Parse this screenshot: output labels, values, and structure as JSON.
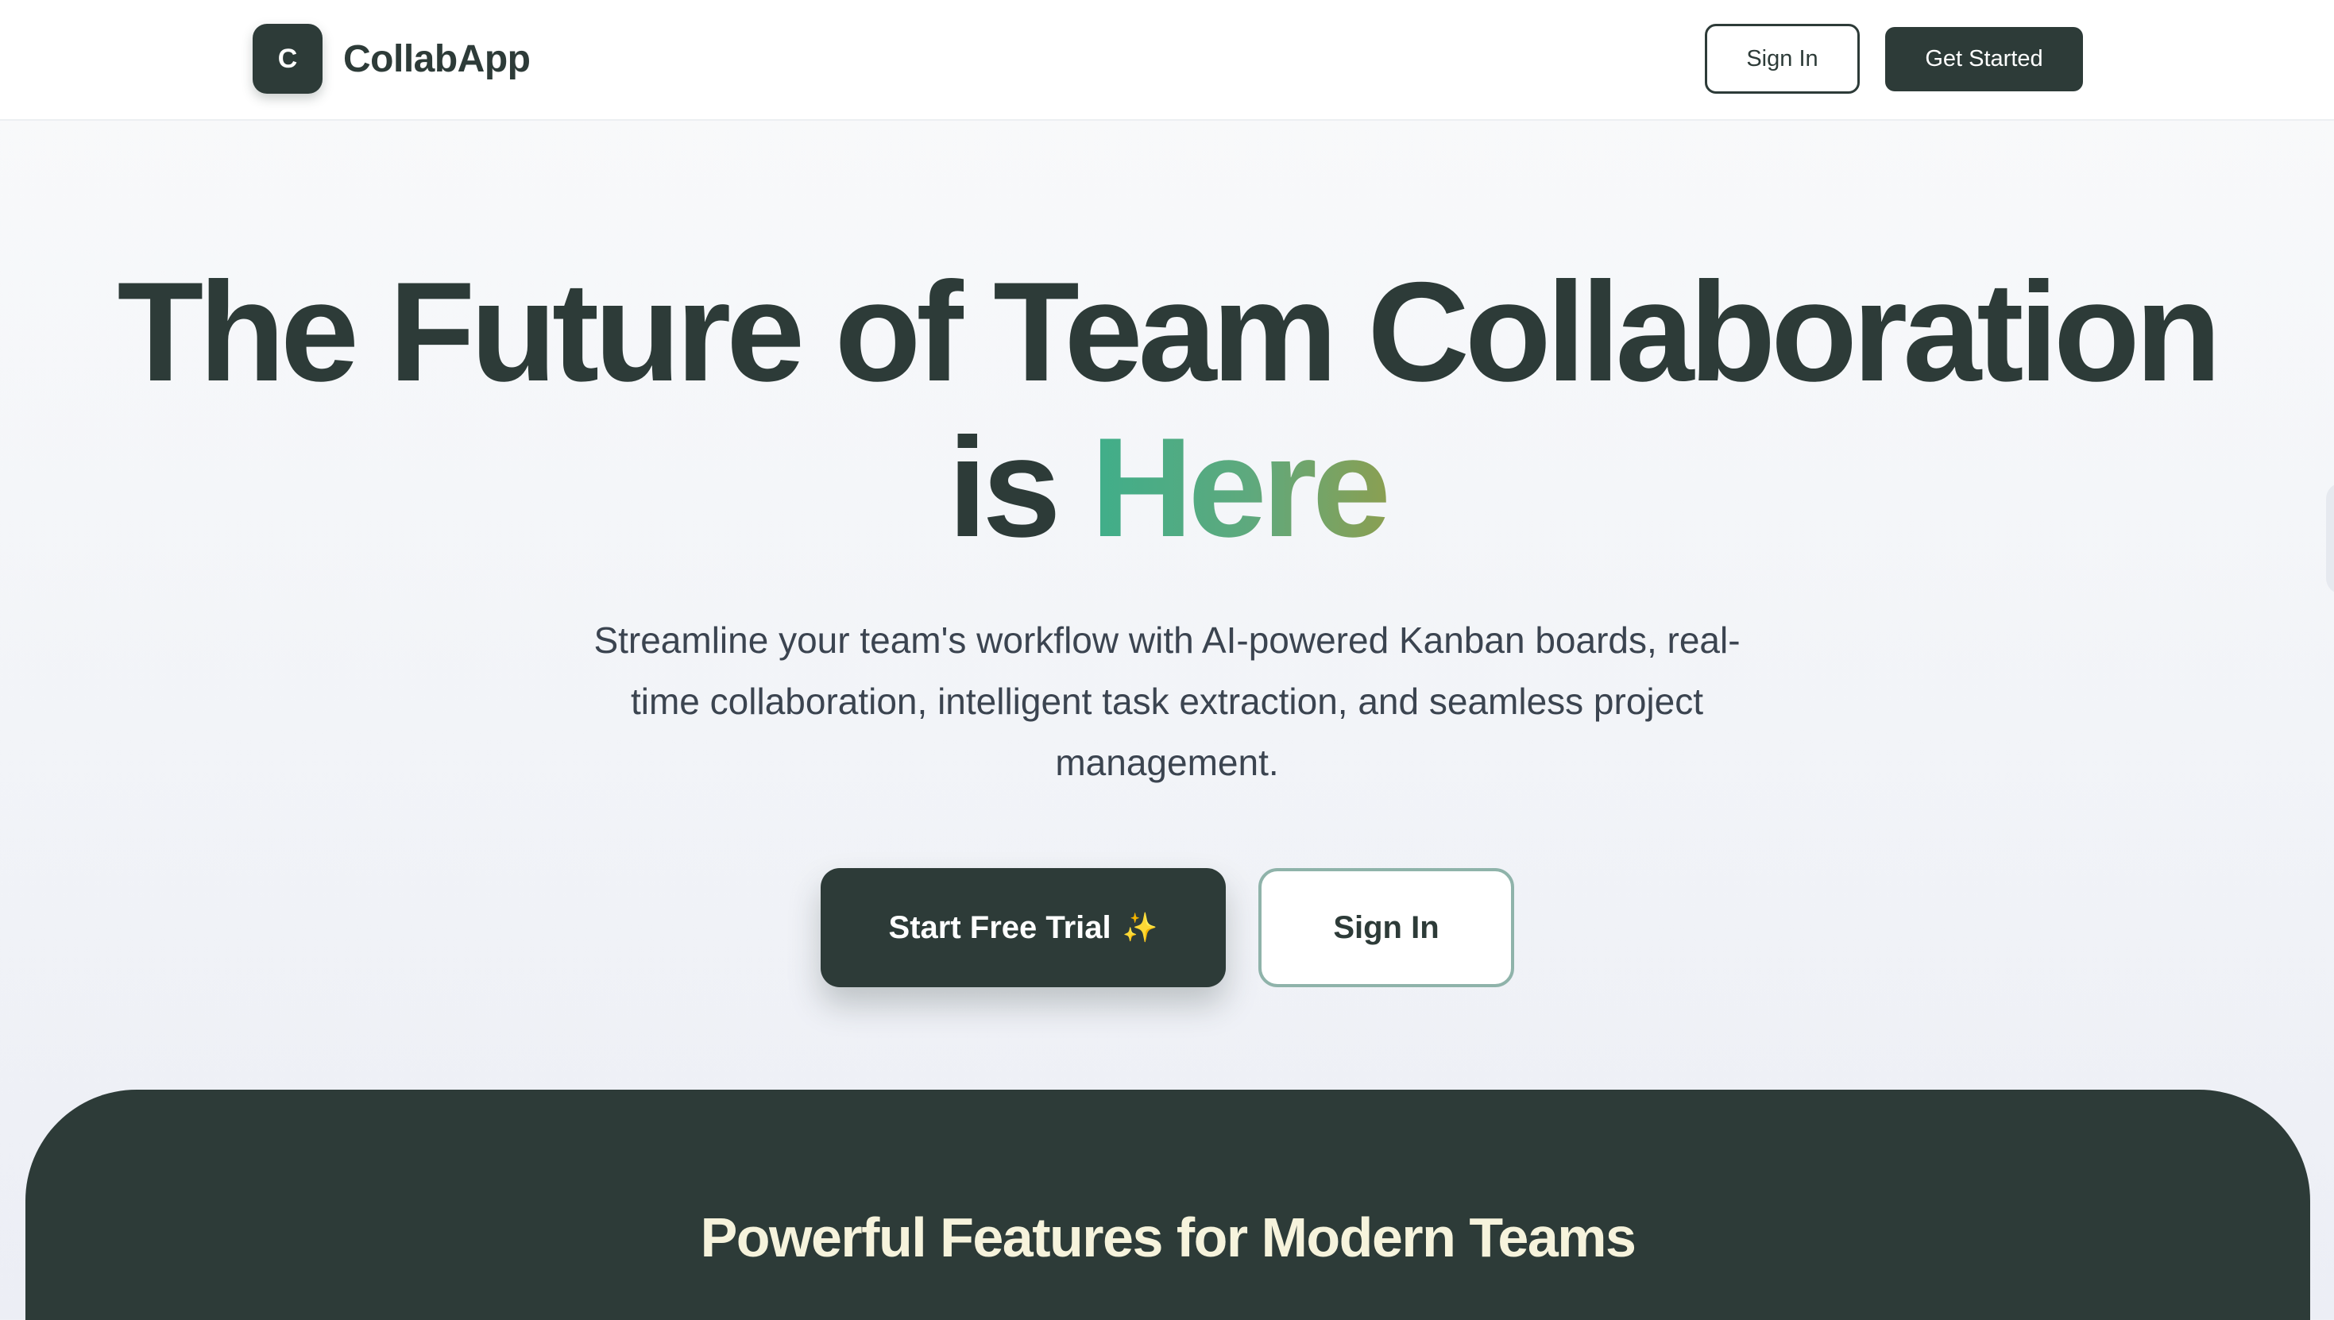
{
  "header": {
    "logo_letter": "C",
    "brand_name": "CollabApp",
    "sign_in_label": "Sign In",
    "get_started_label": "Get Started"
  },
  "hero": {
    "title_line1": "The Future of Team Collaboration",
    "title_line2_prefix": "is ",
    "title_highlight": "Here",
    "subtitle": "Streamline your team's workflow with AI-powered Kanban boards, real-time collaboration, intelligent task extraction, and seamless project management.",
    "primary_cta_label": "Start Free Trial",
    "primary_cta_icon": "✨",
    "secondary_cta_label": "Sign In"
  },
  "features": {
    "title": "Powerful Features for Modern Teams"
  },
  "colors": {
    "primary": "#2d3b38",
    "highlight_gradient_start": "#3fae8a",
    "highlight_gradient_end": "#8a9f52",
    "features_title": "#f6f3dc",
    "outline_button_border": "#8fb3aa"
  },
  "icons": {
    "logo": "letter-badge-icon",
    "sparkle": "sparkles-icon"
  }
}
